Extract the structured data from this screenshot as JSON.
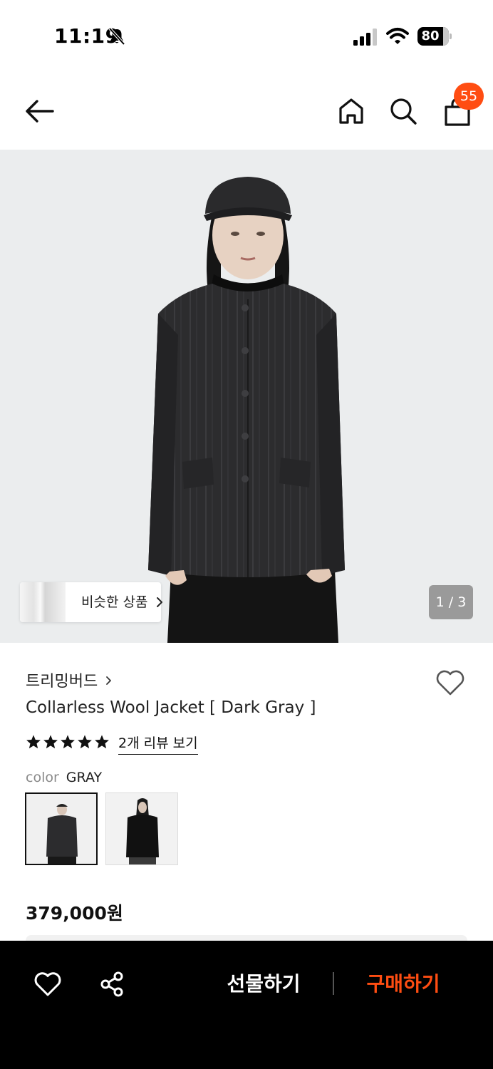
{
  "status_bar": {
    "time": "11:19",
    "battery": "80"
  },
  "header": {
    "cart_count": "55",
    "icons": [
      "back-arrow-icon",
      "home-icon",
      "search-icon",
      "shopping-bag-icon"
    ]
  },
  "gallery": {
    "similar_label": "비슷한 상품",
    "page_indicator": "1 / 3"
  },
  "product": {
    "brand": "트리밍버드",
    "name": "Collarless Wool Jacket [ Dark Gray ]",
    "rating": 5,
    "review_link": "2개 리뷰 보기",
    "color_key": "color",
    "color_value": "GRAY",
    "swatches": [
      "dark-gray",
      "black"
    ],
    "price": "379,000원"
  },
  "bottom_bar": {
    "gift_label": "선물하기",
    "buy_label": "구매하기"
  },
  "colors": {
    "accent": "#ff4d12",
    "bottom_bar_bg": "#000000",
    "image_bg": "#ebedee"
  }
}
